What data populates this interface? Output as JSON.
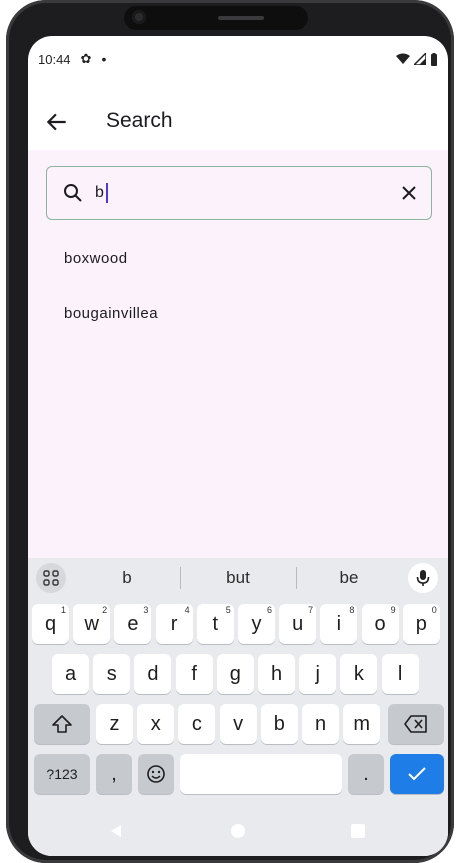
{
  "status_bar": {
    "time": "10:44"
  },
  "appbar": {
    "title": "Search"
  },
  "search": {
    "value": "b"
  },
  "results": [
    "boxwood",
    "bougainvillea"
  ],
  "keyboard": {
    "suggestions": [
      "b",
      "but",
      "be"
    ],
    "row1": [
      {
        "k": "q",
        "h": "1"
      },
      {
        "k": "w",
        "h": "2"
      },
      {
        "k": "e",
        "h": "3"
      },
      {
        "k": "r",
        "h": "4"
      },
      {
        "k": "t",
        "h": "5"
      },
      {
        "k": "y",
        "h": "6"
      },
      {
        "k": "u",
        "h": "7"
      },
      {
        "k": "i",
        "h": "8"
      },
      {
        "k": "o",
        "h": "9"
      },
      {
        "k": "p",
        "h": "0"
      }
    ],
    "row2": [
      "a",
      "s",
      "d",
      "f",
      "g",
      "h",
      "j",
      "k",
      "l"
    ],
    "row3": [
      "z",
      "x",
      "c",
      "v",
      "b",
      "n",
      "m"
    ],
    "symbols_label": "?123",
    "comma_label": ",",
    "period_label": "."
  },
  "colors": {
    "background": "#fbf2fb",
    "accent": "#1e7de6",
    "border": "#8ab59a"
  }
}
